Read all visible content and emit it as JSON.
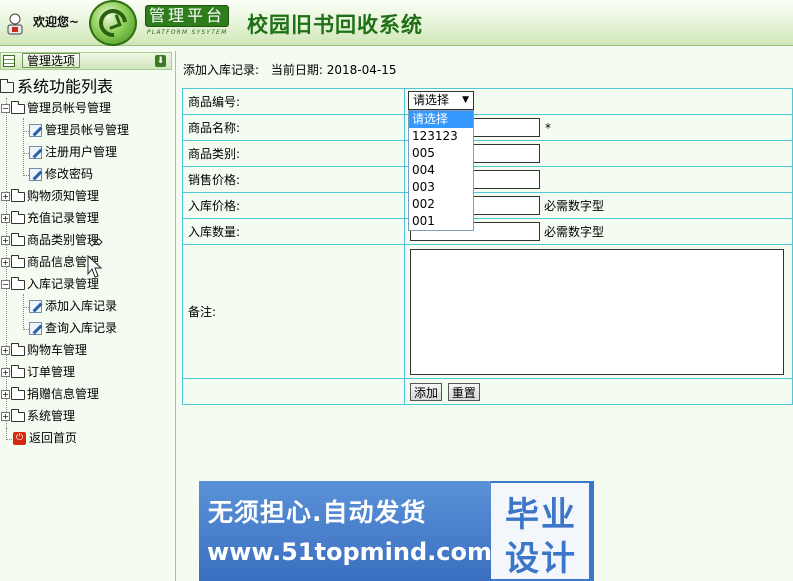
{
  "header": {
    "welcome": "欢迎您~",
    "platform_title": "管理平台",
    "platform_subtitle": "PLATFORM SYSYTEM",
    "app_title": "校园旧书回收系统"
  },
  "sidebar": {
    "header_label": "管理选项",
    "root_label": "系统功能列表",
    "groups": [
      {
        "label": "管理员帐号管理",
        "children": [
          "管理员帐号管理",
          "注册用户管理",
          "修改密码"
        ]
      },
      {
        "label": "购物须知管理"
      },
      {
        "label": "充值记录管理"
      },
      {
        "label": "商品类别管理"
      },
      {
        "label": "商品信息管理"
      },
      {
        "label": "入库记录管理",
        "children": [
          "添加入库记录",
          "查询入库记录"
        ]
      },
      {
        "label": "购物车管理"
      },
      {
        "label": "订单管理"
      },
      {
        "label": "捐赠信息管理"
      },
      {
        "label": "系统管理"
      }
    ],
    "home_label": "返回首页"
  },
  "main": {
    "record_label": "添加入库记录:",
    "date_label": "当前日期:",
    "date_value": "2018-04-15",
    "fields": {
      "code_label": "商品编号:",
      "name_label": "商品名称:",
      "category_label": "商品类别:",
      "sale_price_label": "销售价格:",
      "in_price_label": "入库价格:",
      "quantity_label": "入库数量:",
      "notes_label": "备注:"
    },
    "required_mark": "*",
    "numeric_hint": "必需数字型",
    "select": {
      "selected": "请选择",
      "options": [
        "请选择",
        "123123",
        "005",
        "004",
        "003",
        "002",
        "001"
      ]
    },
    "buttons": {
      "add": "添加",
      "reset": "重置"
    }
  },
  "banner": {
    "slogan": "无须担心.自动发货",
    "url": "www.51topmind.com",
    "big1": "毕业",
    "big2": "设计"
  }
}
